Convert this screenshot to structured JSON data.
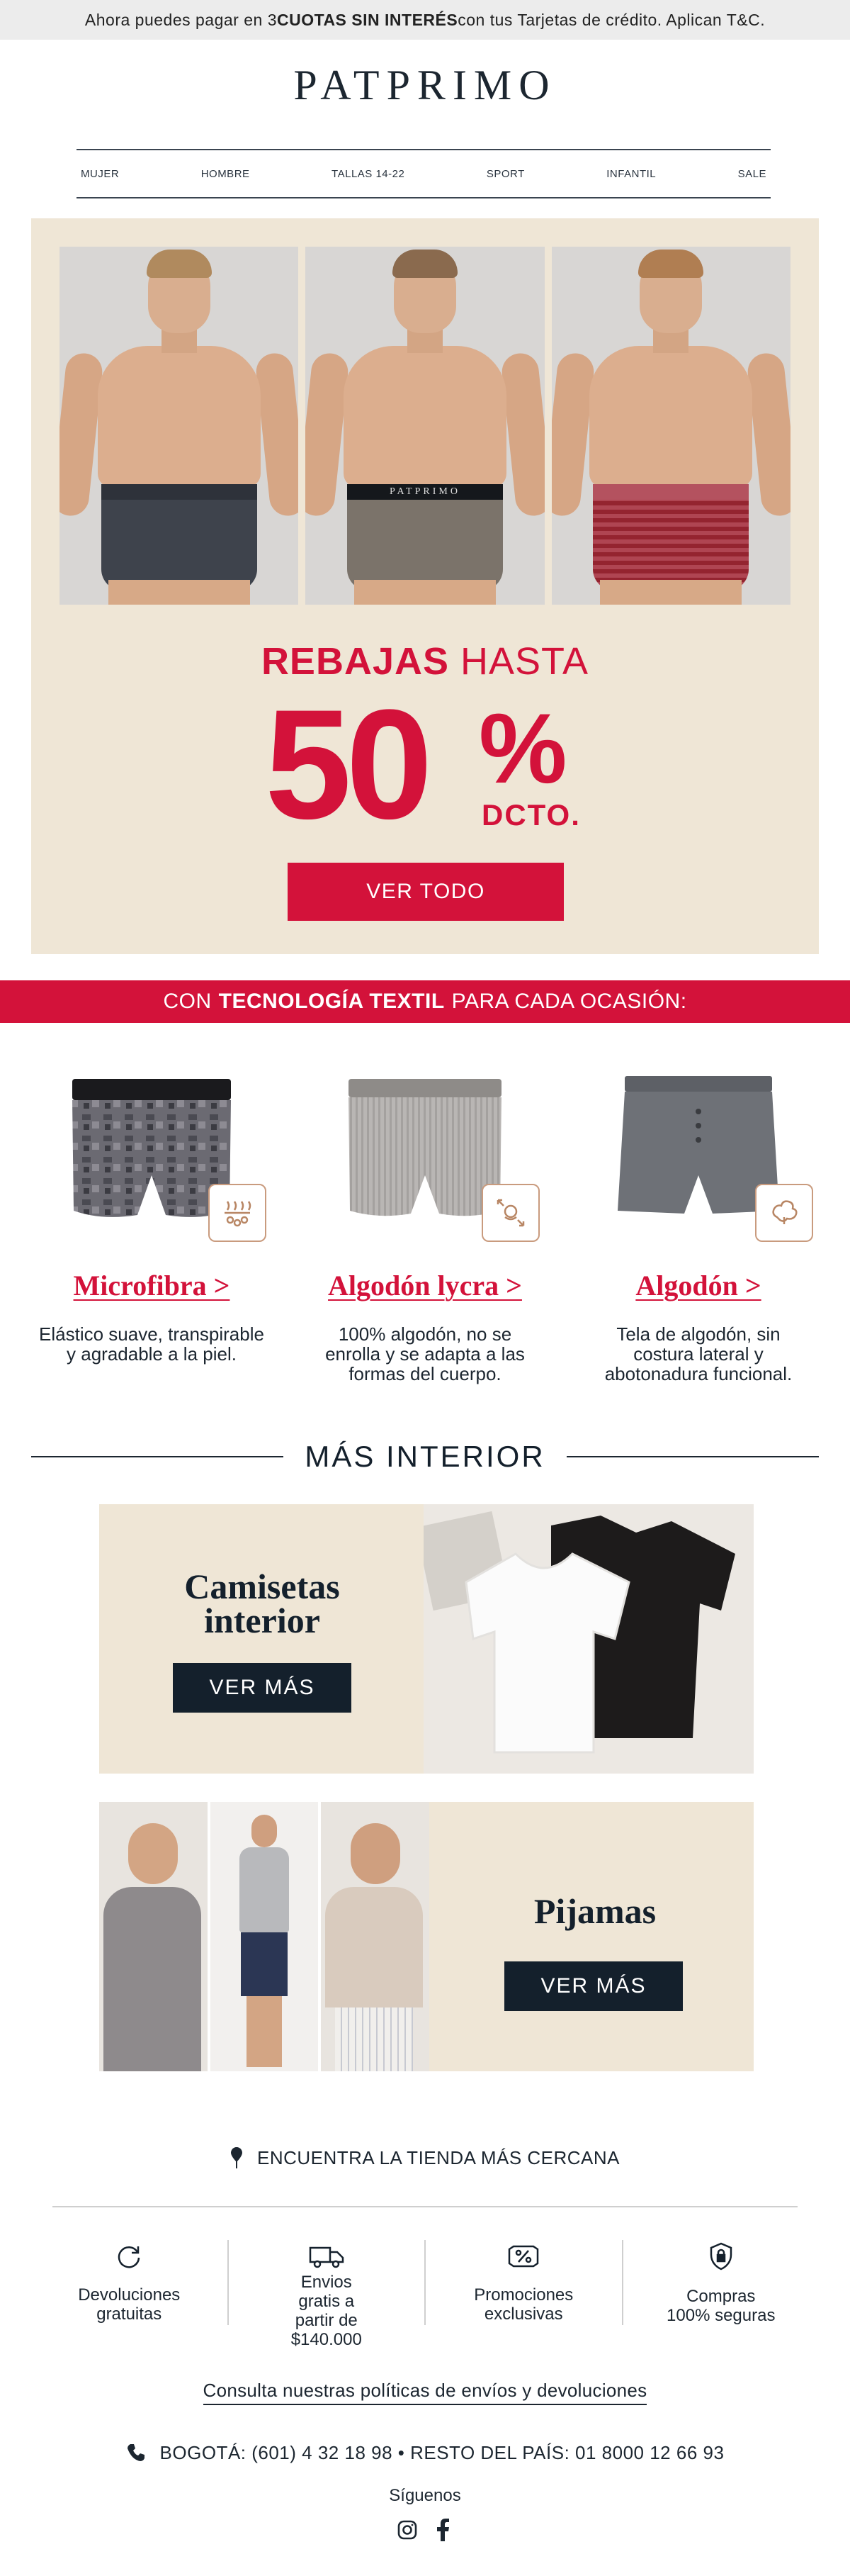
{
  "promo_bar": {
    "pre": "Ahora puedes pagar en 3 ",
    "bold": "CUOTAS SIN INTERÉS",
    "post": " con tus Tarjetas de crédito. Aplican T&C."
  },
  "brand": {
    "logo": "PATPRIMO"
  },
  "nav": {
    "items": [
      "MUJER",
      "HOMBRE",
      "TALLAS 14-22",
      "SPORT",
      "INFANTIL",
      "SALE"
    ]
  },
  "hero": {
    "title_bold": "REBAJAS",
    "title_rest": "HASTA",
    "discount_number": "50",
    "discount_symbol": "%",
    "discount_suffix": "DCTO.",
    "cta": "VER TODO",
    "band_text": "PATPRIMO",
    "colors": {
      "bg": "#efe6d6",
      "accent": "#d3123a"
    }
  },
  "tech_banner": {
    "pre": "CON ",
    "bold": "TECNOLOGÍA TEXTIL",
    "post": " PARA CADA OCASIÓN:"
  },
  "tech": {
    "items": [
      {
        "name": "Microfibra >",
        "desc": "Elástico suave, transpirable y agradable a la piel.",
        "icon": "microfiber-icon"
      },
      {
        "name": "Algodón lycra >",
        "desc": "100% algodón, no se enrolla y se adapta a las formas del cuerpo.",
        "icon": "cotton-stretch-icon"
      },
      {
        "name": "Algodón >",
        "desc": "Tela de algodón, sin costura lateral y abotonadura funcional.",
        "icon": "cotton-icon"
      }
    ]
  },
  "more": {
    "title": "MÁS INTERIOR",
    "cards": [
      {
        "title": "Camisetas interior",
        "cta": "VER MÁS"
      },
      {
        "title": "Pijamas",
        "cta": "VER MÁS"
      }
    ]
  },
  "store": {
    "label": "ENCUENTRA LA TIENDA MÁS CERCANA",
    "icon": "map-pin-icon"
  },
  "benefits": [
    {
      "label": "Devoluciones gratuitas",
      "icon": "refresh-icon"
    },
    {
      "label": "Envios gratis a partir de $140.000",
      "icon": "truck-icon"
    },
    {
      "label": "Promociones exclusivas",
      "icon": "discount-tag-icon"
    },
    {
      "label": "Compras 100% seguras",
      "icon": "shield-icon"
    }
  ],
  "policy_link": "Consulta nuestras políticas de envíos y devoluciones",
  "phone": {
    "text": "BOGOTÁ: (601) 4 32 18 98 • RESTO DEL PAÍS: 01 8000 12 66 93",
    "icon": "phone-icon"
  },
  "social": {
    "label": "Síguenos",
    "icons": [
      "instagram-icon",
      "facebook-icon"
    ]
  }
}
